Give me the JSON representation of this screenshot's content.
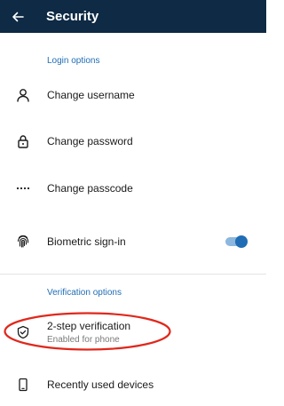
{
  "header": {
    "title": "Security",
    "back_icon": "arrow-left-icon"
  },
  "login_section": {
    "title": "Login options",
    "items": [
      {
        "label": "Change username",
        "icon": "person-icon"
      },
      {
        "label": "Change password",
        "icon": "lock-icon"
      },
      {
        "label": "Change passcode",
        "icon": "dots-icon"
      },
      {
        "label": "Biometric sign-in",
        "icon": "fingerprint-icon",
        "toggle_on": true
      }
    ]
  },
  "verification_section": {
    "title": "Verification options",
    "items": [
      {
        "label": "2-step verification",
        "subtitle": "Enabled for phone",
        "icon": "shield-check-icon",
        "highlighted": true
      },
      {
        "label": "Recently used devices",
        "icon": "phone-icon"
      }
    ]
  },
  "colors": {
    "app_bar": "#0e2a44",
    "accent": "#1f6db5",
    "highlight_circle": "#e0281c"
  }
}
